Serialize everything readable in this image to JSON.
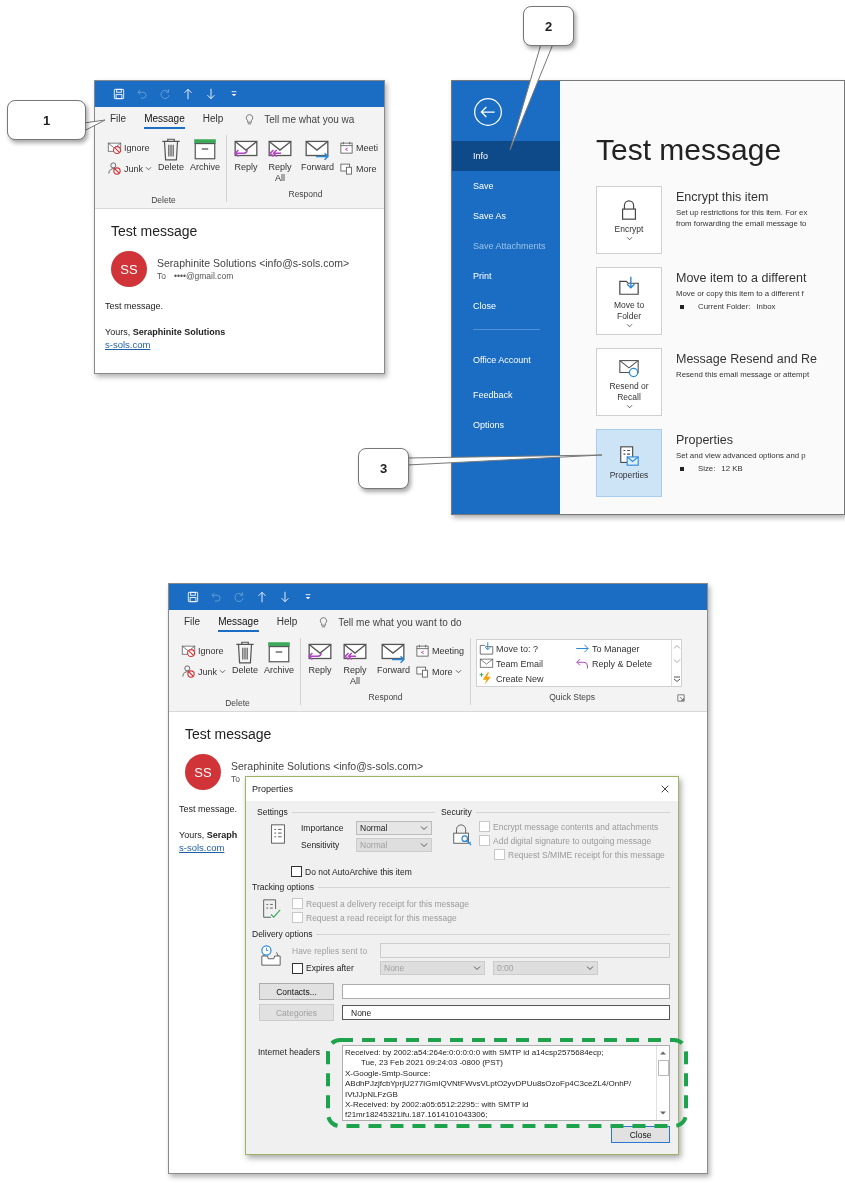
{
  "callouts": [
    {
      "label": "1"
    },
    {
      "label": "2"
    },
    {
      "label": "3"
    }
  ],
  "top_left_window": {
    "quick_access": [
      {
        "kind": "save",
        "disabled": false
      },
      {
        "kind": "undo",
        "disabled": true
      },
      {
        "kind": "redo",
        "disabled": true
      },
      {
        "kind": "up",
        "disabled": false
      },
      {
        "kind": "down",
        "disabled": false
      },
      {
        "kind": "customize",
        "disabled": false
      }
    ],
    "tabs": [
      {
        "label": "File",
        "selected": false
      },
      {
        "label": "Message",
        "selected": true
      },
      {
        "label": "Help",
        "selected": false
      }
    ],
    "tell_me": "Tell me what you wa",
    "ribbon": [
      {
        "kind": "delete",
        "label": "Delete",
        "items": [
          {
            "kind": "ignore",
            "label": "Ignore",
            "dropdown": false
          },
          {
            "kind": "junk",
            "label": "Junk",
            "dropdown": true
          },
          {
            "kind": "delete",
            "label": "Delete",
            "dropdown": false
          },
          {
            "kind": "archive",
            "label": "Archive",
            "dropdown": false
          }
        ]
      },
      {
        "kind": "respond",
        "label": "Respond",
        "items": [
          {
            "kind": "reply",
            "label": "Reply",
            "dropdown": false
          },
          {
            "kind": "reply_all",
            "label": "Reply All",
            "dropdown": false
          },
          {
            "kind": "forward",
            "label": "Forward",
            "dropdown": false
          },
          {
            "kind": "meeting",
            "label": "Meeti",
            "dropdown": false
          },
          {
            "kind": "more",
            "label": "More",
            "dropdown": false
          }
        ]
      }
    ],
    "message": {
      "subject": "Test message",
      "avatar": "SS",
      "sender": "Seraphinite Solutions <info@s-sols.com>",
      "to_label": "To",
      "to": "••••@gmail.com",
      "body": "Test message.",
      "closing": "Yours, **Seraphinite Solutions**",
      "link": "s-sols.com"
    }
  },
  "backstage_window": {
    "menu": [
      {
        "label": "Info",
        "selected": true,
        "disabled": false
      },
      {
        "label": "Save",
        "selected": false,
        "disabled": false
      },
      {
        "label": "Save As",
        "selected": false,
        "disabled": false
      },
      {
        "label": "Save Attachments",
        "selected": false,
        "disabled": true
      },
      {
        "label": "Print",
        "selected": false,
        "disabled": false
      },
      {
        "label": "Close",
        "selected": false,
        "disabled": false
      }
    ],
    "menu_lower": [
      {
        "label": "Office Account",
        "selected": false,
        "disabled": false
      },
      {
        "label": "Feedback",
        "selected": false,
        "disabled": false
      },
      {
        "label": "Options",
        "selected": false,
        "disabled": false
      }
    ],
    "title": "Test message",
    "actions": [
      {
        "kind": "encrypt",
        "button": "Encrypt",
        "dropdown": true,
        "selected": false,
        "heading": "Encrypt this item",
        "lines": [
          "Set up restrictions for this item. For ex",
          "from forwarding the email message to"
        ]
      },
      {
        "kind": "move",
        "button": "Move to Folder",
        "dropdown": true,
        "selected": false,
        "heading": "Move item to a different",
        "lines": [
          "Move or copy this item to a different f"
        ],
        "detail": {
          "label": "Current Folder:",
          "value": "Inbox"
        }
      },
      {
        "kind": "resend",
        "button": "Resend or Recall",
        "dropdown": true,
        "selected": false,
        "heading": "Message Resend and Re",
        "lines": [
          "Resend this email message or attempt"
        ]
      },
      {
        "kind": "properties",
        "button": "Properties",
        "selected": true,
        "heading": "Properties",
        "lines": [
          "Set and view advanced options and p"
        ],
        "detail": {
          "label": "Size:",
          "value": "12 KB"
        }
      }
    ]
  },
  "bottom_window": {
    "quick_access": [
      {
        "kind": "save",
        "disabled": false
      },
      {
        "kind": "undo",
        "disabled": true
      },
      {
        "kind": "redo",
        "disabled": true
      },
      {
        "kind": "up",
        "disabled": false
      },
      {
        "kind": "down",
        "disabled": false
      },
      {
        "kind": "customize",
        "disabled": false
      }
    ],
    "tabs": [
      {
        "label": "File",
        "selected": false
      },
      {
        "label": "Message",
        "selected": true
      },
      {
        "label": "Help",
        "selected": false
      }
    ],
    "tell_me": "Tell me what you want to do",
    "ribbon": [
      {
        "kind": "delete",
        "label": "Delete",
        "items": [
          {
            "kind": "ignore",
            "label": "Ignore",
            "dropdown": false
          },
          {
            "kind": "junk",
            "label": "Junk",
            "dropdown": true
          },
          {
            "kind": "delete",
            "label": "Delete",
            "dropdown": false
          },
          {
            "kind": "archive",
            "label": "Archive",
            "dropdown": false
          }
        ]
      },
      {
        "kind": "respond",
        "label": "Respond",
        "items": [
          {
            "kind": "reply",
            "label": "Reply",
            "dropdown": false
          },
          {
            "kind": "reply_all",
            "label": "Reply All",
            "dropdown": false
          },
          {
            "kind": "forward",
            "label": "Forward",
            "dropdown": false
          },
          {
            "kind": "meeting",
            "label": "Meeting",
            "dropdown": false
          },
          {
            "kind": "more",
            "label": "More",
            "dropdown": true
          }
        ]
      },
      {
        "kind": "quick_steps",
        "label": "Quick Steps",
        "items": [
          {
            "kind": "move_to",
            "label": "Move to: ?",
            "dropdown": false
          },
          {
            "kind": "to_manager",
            "label": "To Manager",
            "dropdown": false
          },
          {
            "kind": "team_email",
            "label": "Team Email",
            "dropdown": false
          },
          {
            "kind": "reply_delete",
            "label": "Reply & Delete",
            "dropdown": false
          },
          {
            "kind": "create_new",
            "label": "Create New",
            "dropdown": false
          }
        ]
      }
    ],
    "message": {
      "subject": "Test message",
      "avatar": "SS",
      "sender": "Seraphinite Solutions <info@s-sols.com>",
      "to_label": "To",
      "body": "Test message.",
      "closing": "Yours, **Seraph**",
      "link": "s-sols.com"
    }
  },
  "properties_dialog": {
    "title": "Properties",
    "settings": {
      "heading": "Settings",
      "fields": [
        {
          "label": "Importance",
          "value": "Normal",
          "disabled": false
        },
        {
          "label": "Sensitivity",
          "value": "Normal",
          "disabled": true
        }
      ]
    },
    "security": {
      "heading": "Security",
      "options": [
        {
          "label": "Encrypt message contents and attachments",
          "checked": false,
          "disabled": true,
          "indented": false
        },
        {
          "label": "Add digital signature to outgoing message",
          "checked": false,
          "disabled": true,
          "indented": false
        },
        {
          "label": "Request S/MIME receipt for this message",
          "checked": false,
          "disabled": true,
          "indented": true
        }
      ]
    },
    "auto_archive": {
      "label": "Do not AutoArchive this item",
      "checked": false,
      "disabled": false
    },
    "tracking": {
      "heading": "Tracking options",
      "options": [
        {
          "label": "Request a delivery receipt for this message",
          "checked": false,
          "disabled": true
        },
        {
          "label": "Request a read receipt for this message",
          "checked": false,
          "disabled": true
        }
      ]
    },
    "delivery": {
      "heading": "Delivery options",
      "replies": {
        "label": "Have replies sent to",
        "disabled": true
      },
      "expires": {
        "label": "Expires after",
        "checked": false,
        "disabled": false,
        "date": "None",
        "time": "0:00",
        "selects_disabled": true
      }
    },
    "contacts": {
      "button": "Contacts...",
      "disabled": false
    },
    "categories": {
      "button": "Categories",
      "disabled": true,
      "value": "None"
    },
    "headers": {
      "label": "Internet headers",
      "lines": [
        {
          "text": "Received: by 2002:a54:264e:0:0:0:0:0 with SMTP id a14csp2575684ecp;",
          "indented": false
        },
        {
          "text": "Tue, 23 Feb 2021 09:24:03 -0800 (PST)",
          "indented": true
        },
        {
          "text": "X-Google-Smtp-Source:",
          "indented": false
        },
        {
          "text": "ABdhPJzjfcbYprjU277IGmIQVNtFWvsVLptO2yvDPUu8sOzoFp4C3ceZL4/OnhP/",
          "indented": false
        },
        {
          "text": "IVtJJpNLFzGB",
          "indented": false
        },
        {
          "text": "X-Received: by 2002:a05:6512:2295:: with SMTP id",
          "indented": false
        },
        {
          "text": "f21mr18245321lfu.187.1614101043306;",
          "indented": false
        }
      ]
    },
    "close": "Close"
  }
}
